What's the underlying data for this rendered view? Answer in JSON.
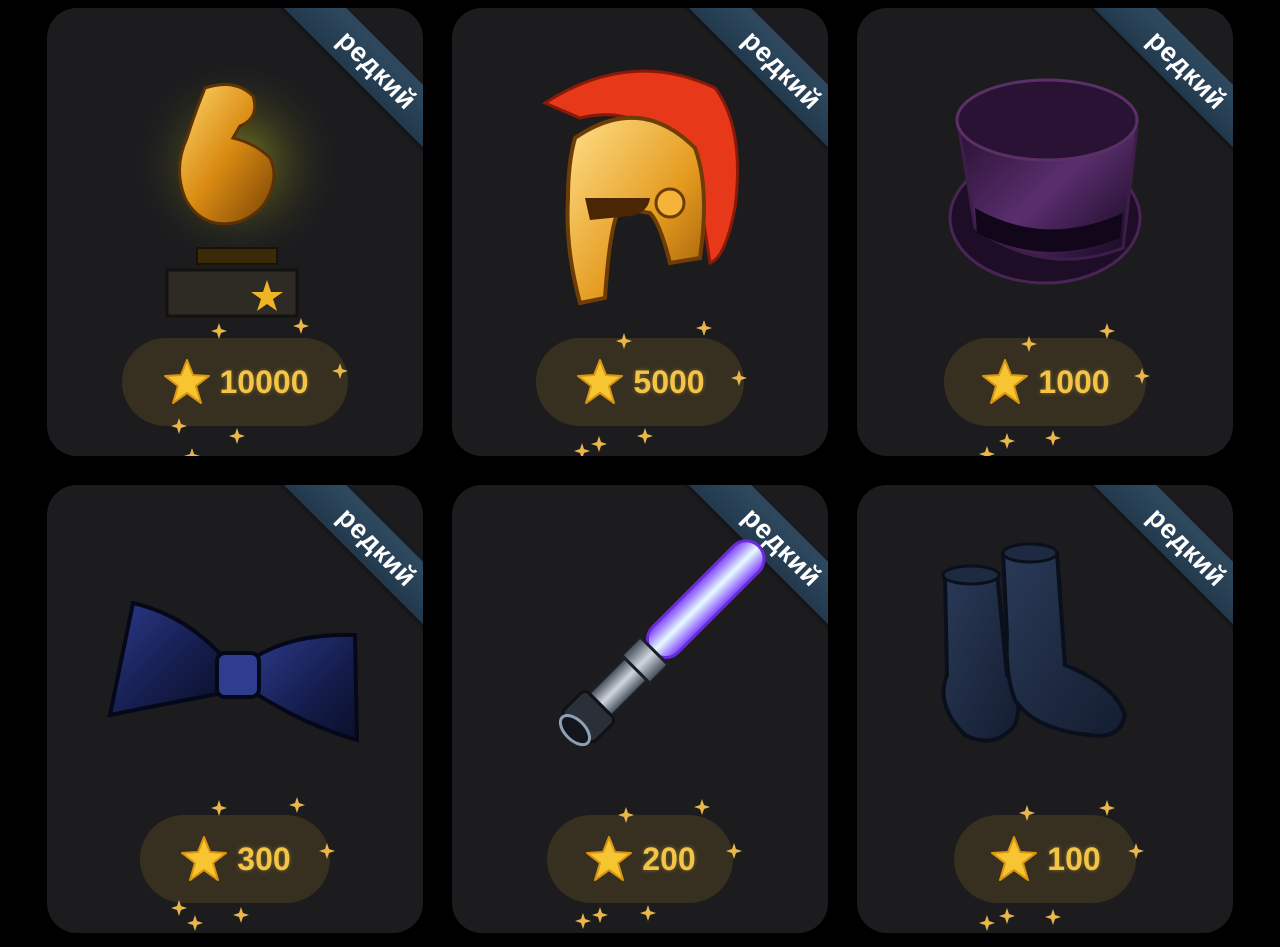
{
  "gifts": [
    {
      "badge": "редкий",
      "icon": "trophy-bicep-icon",
      "price": "10000"
    },
    {
      "badge": "редкий",
      "icon": "spartan-helmet-icon",
      "price": "5000"
    },
    {
      "badge": "редкий",
      "icon": "top-hat-icon",
      "price": "1000"
    },
    {
      "badge": "редкий",
      "icon": "bow-tie-icon",
      "price": "300"
    },
    {
      "badge": "редкий",
      "icon": "lightsaber-icon",
      "price": "200"
    },
    {
      "badge": "редкий",
      "icon": "socks-icon",
      "price": "100"
    }
  ],
  "colors": {
    "background": "#000000",
    "card": "#1c1c1e",
    "ribbon": "#2f4a60",
    "price_text": "#f3c446",
    "price_pill": "#3a321c"
  },
  "currency_icon": "star-icon"
}
